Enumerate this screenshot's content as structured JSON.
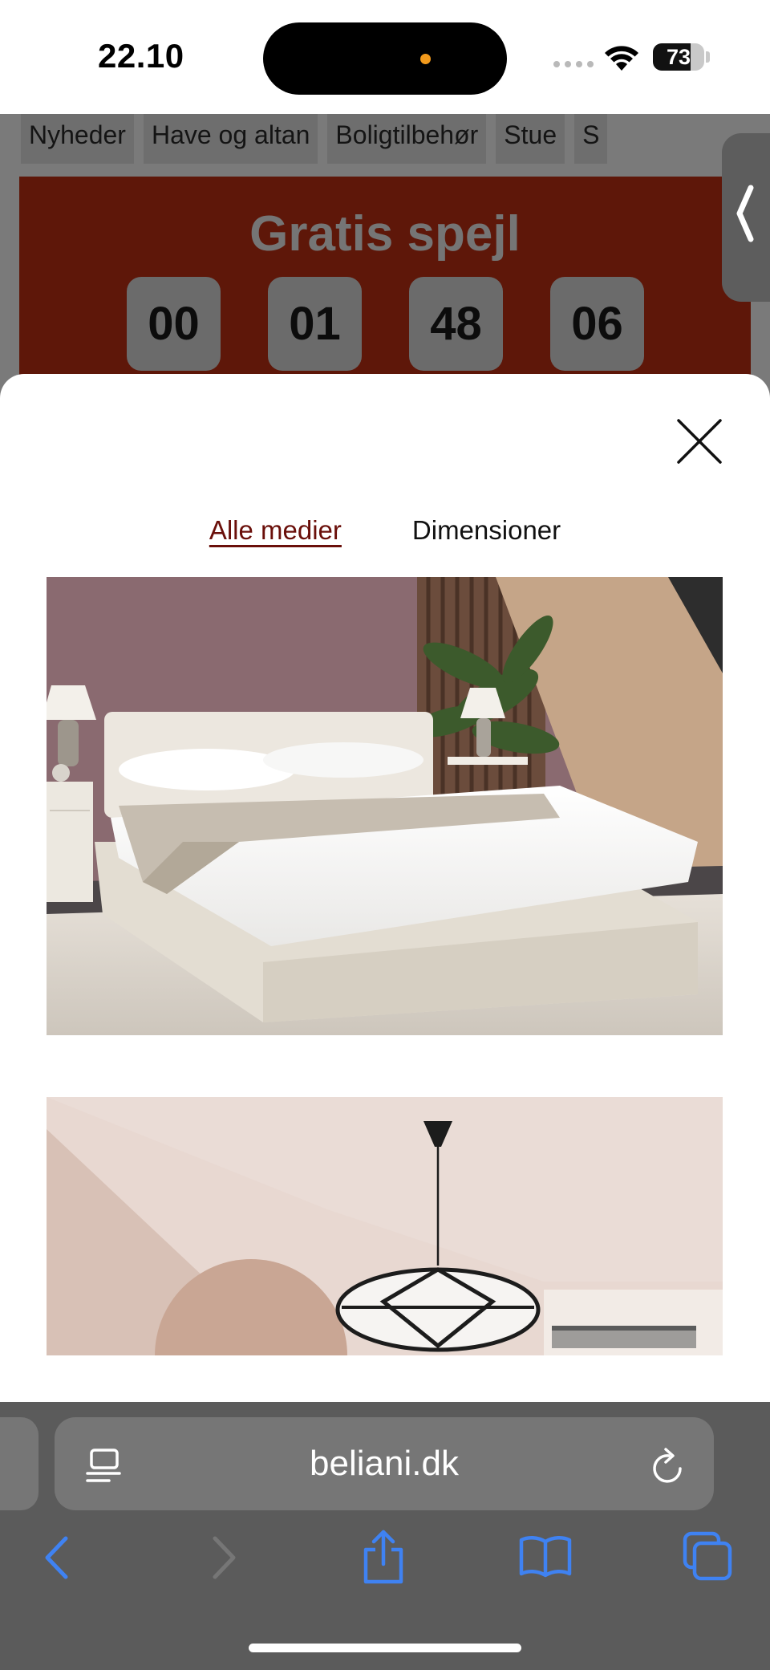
{
  "status_bar": {
    "time": "22.10",
    "battery_level": "73",
    "battery_fraction": 0.73
  },
  "nav": {
    "categories": [
      "Nyheder",
      "Have og altan",
      "Boligtilbehør",
      "Stue",
      "S"
    ]
  },
  "promo": {
    "title": "Gratis spejl",
    "countdown": [
      "00",
      "01",
      "48",
      "06"
    ]
  },
  "modal": {
    "tabs": [
      {
        "label": "Alle medier",
        "active": true
      },
      {
        "label": "Dimensioner",
        "active": false
      }
    ],
    "media": [
      {
        "alt": "bed-photo"
      },
      {
        "alt": "pendant-lamp-photo"
      }
    ]
  },
  "browser": {
    "url": "beliani.dk"
  },
  "icons": {
    "close": "close-icon",
    "reader": "reader-icon",
    "reload": "reload-icon",
    "back": "back-icon",
    "forward": "forward-icon",
    "share": "share-icon",
    "bookmarks": "bookmarks-icon",
    "tabs": "tabs-icon"
  },
  "colors": {
    "accent": "#6a0f0a",
    "promo_bg": "#5e1709",
    "toolbar_blue": "#3f82f2"
  }
}
